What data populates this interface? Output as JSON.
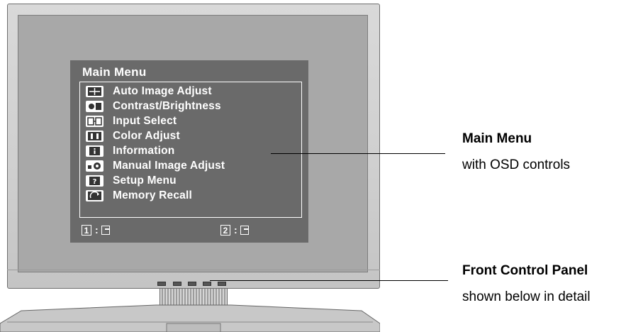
{
  "osd": {
    "title": "Main Menu",
    "items": [
      {
        "label": "Auto Image Adjust",
        "icon": "auto-image-adjust-icon"
      },
      {
        "label": "Contrast/Brightness",
        "icon": "contrast-brightness-icon"
      },
      {
        "label": "Input Select",
        "icon": "input-select-icon"
      },
      {
        "label": "Color Adjust",
        "icon": "color-adjust-icon"
      },
      {
        "label": "Information",
        "icon": "information-icon"
      },
      {
        "label": "Manual Image Adjust",
        "icon": "manual-image-adjust-icon"
      },
      {
        "label": "Setup Menu",
        "icon": "setup-menu-icon"
      },
      {
        "label": "Memory Recall",
        "icon": "memory-recall-icon"
      }
    ],
    "footer": [
      {
        "key": "1",
        "sep": ":"
      },
      {
        "key": "2",
        "sep": ":"
      }
    ]
  },
  "callouts": {
    "main_menu": {
      "title": "Main Menu",
      "subtitle": "with OSD controls"
    },
    "front_panel": {
      "title": "Front Control Panel",
      "subtitle": "shown below in detail"
    }
  },
  "colors": {
    "osd_bg": "#6a6a6a",
    "screen": "#a8a8a8",
    "bezel": "#d4d4d4"
  }
}
